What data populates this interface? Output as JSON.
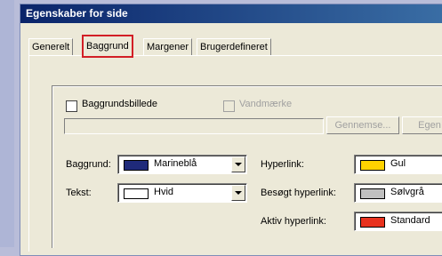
{
  "window": {
    "title": "Egenskaber for side"
  },
  "tabs": [
    {
      "label": "Generelt"
    },
    {
      "label": "Baggrund"
    },
    {
      "label": "Margener"
    },
    {
      "label": "Brugerdefineret"
    }
  ],
  "background_image": {
    "label": "Baggrundsbillede",
    "checked": false
  },
  "watermark": {
    "label": "Vandmærke",
    "checked": false,
    "enabled": false
  },
  "buttons": {
    "browse": "Gennemse...",
    "properties": "Egen"
  },
  "colors": {
    "background": {
      "label": "Baggrund:",
      "value": "Marineblå",
      "swatch": "#1f2a7a"
    },
    "text": {
      "label": "Tekst:",
      "value": "Hvid",
      "swatch": "#ffffff"
    },
    "hyperlink": {
      "label": "Hyperlink:",
      "value": "Gul",
      "swatch": "#ffd200"
    },
    "visited": {
      "label": "Besøgt hyperlink:",
      "value": "Sølvgrå",
      "swatch": "#c0c0c0"
    },
    "active": {
      "label": "Aktiv hyperlink:",
      "value": "Standard",
      "swatch": "#e8321e"
    }
  }
}
